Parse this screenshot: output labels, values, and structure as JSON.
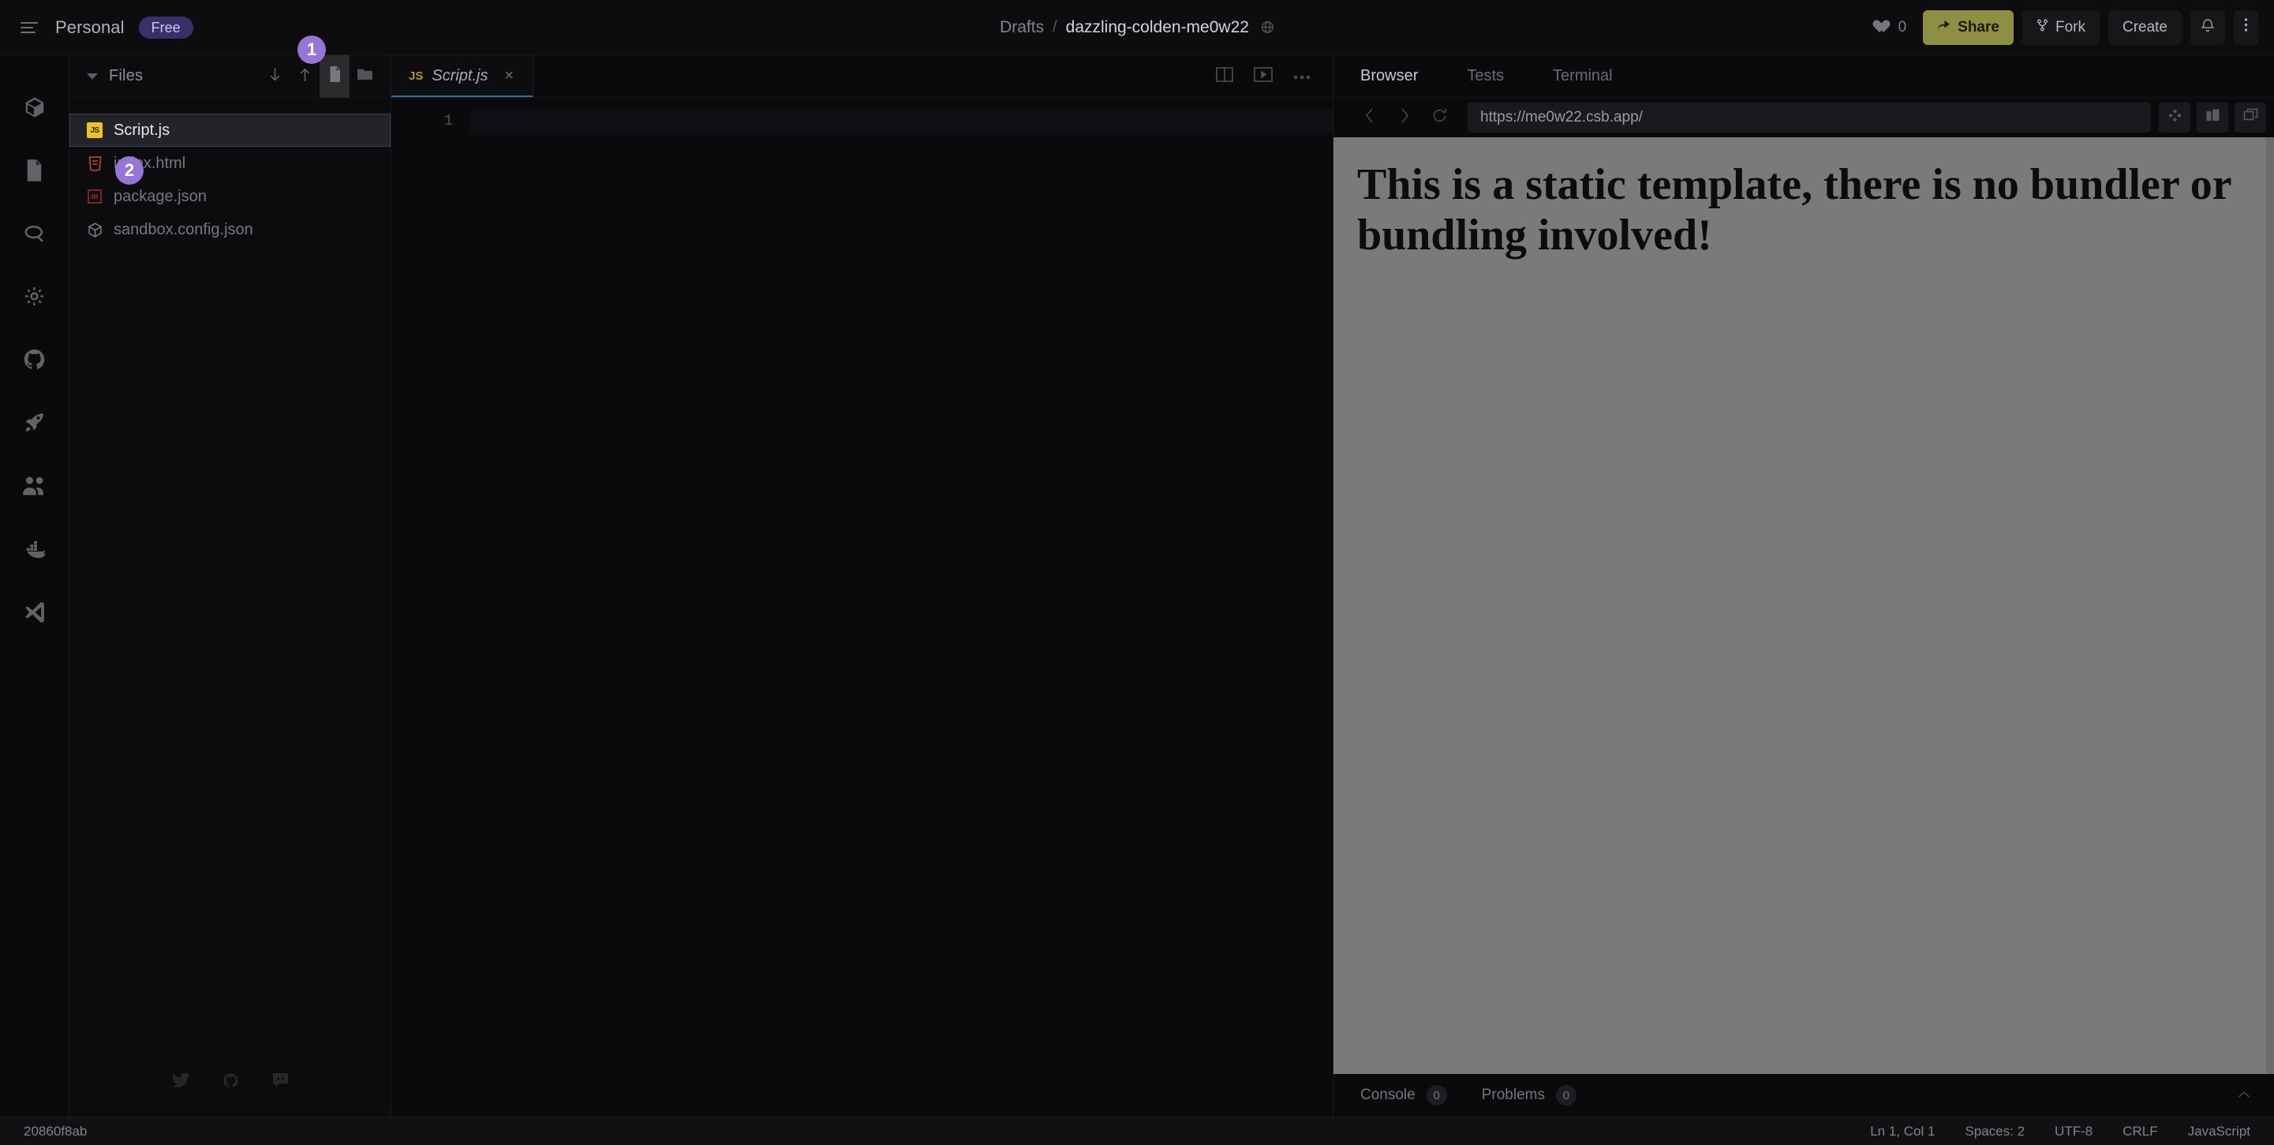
{
  "topbar": {
    "menu_icon": "hamburger-icon",
    "workspace": "Personal",
    "plan": "Free",
    "breadcrumb_root": "Drafts",
    "breadcrumb_sep": "/",
    "breadcrumb_current": "dazzling-colden-me0w22",
    "visibility_icon": "globe-icon",
    "like_count": "0",
    "share_label": "Share",
    "fork_label": "Fork",
    "create_label": "Create",
    "notifications_icon": "bell-icon",
    "more_icon": "more-vertical-icon",
    "share_bg": "#8d8f45",
    "plan_bg": "#3a2f6b"
  },
  "rail": {
    "items": [
      {
        "icon": "box-icon",
        "name": "sandbox-explorer"
      },
      {
        "icon": "file-icon",
        "name": "files"
      },
      {
        "icon": "search-icon",
        "name": "search"
      },
      {
        "icon": "gear-icon",
        "name": "settings"
      },
      {
        "icon": "github-icon",
        "name": "github"
      },
      {
        "icon": "rocket-icon",
        "name": "deploy"
      },
      {
        "icon": "people-icon",
        "name": "live-collaboration"
      },
      {
        "icon": "docker-icon",
        "name": "docker"
      },
      {
        "icon": "vscode-icon",
        "name": "open-in-vscode"
      }
    ]
  },
  "sidebar": {
    "title": "Files",
    "collapse_icon": "chevron-down-icon",
    "actions": [
      {
        "icon": "download-icon",
        "name": "download"
      },
      {
        "icon": "upload-icon",
        "name": "upload"
      },
      {
        "icon": "new-file-icon",
        "name": "new-file",
        "active": true
      },
      {
        "icon": "new-folder-icon",
        "name": "new-folder"
      }
    ],
    "files": [
      {
        "name": "Script.js",
        "icon": "js-icon",
        "selected": true
      },
      {
        "name": "index.html",
        "icon": "html-icon",
        "selected": false
      },
      {
        "name": "package.json",
        "icon": "npm-icon",
        "selected": false
      },
      {
        "name": "sandbox.config.json",
        "icon": "codesandbox-icon",
        "selected": false
      }
    ],
    "footer_icons": [
      "twitter-icon",
      "github-icon",
      "discord-icon"
    ]
  },
  "editor": {
    "tabs": [
      {
        "label": "Script.js",
        "badge": "JS",
        "close": "×",
        "active": true
      }
    ],
    "actions": [
      {
        "icon": "split-editor-icon",
        "name": "split-editor"
      },
      {
        "icon": "preview-icon",
        "name": "toggle-preview"
      },
      {
        "icon": "more-horizontal-icon",
        "name": "editor-options"
      }
    ],
    "line_numbers": [
      "1"
    ],
    "code_lines": [
      ""
    ]
  },
  "preview": {
    "tabs": [
      {
        "label": "Browser",
        "active": true
      },
      {
        "label": "Tests",
        "active": false
      },
      {
        "label": "Terminal",
        "active": false
      }
    ],
    "nav": {
      "back_icon": "chevron-left-icon",
      "forward_icon": "chevron-right-icon",
      "reload_icon": "reload-icon"
    },
    "url": "https://me0w22.csb.app/",
    "url_placeholder": "https://me0w22.csb.app/",
    "tools": [
      {
        "icon": "move-icon",
        "name": "pick-element"
      },
      {
        "icon": "responsive-icon",
        "name": "responsive-mode"
      },
      {
        "icon": "open-new-window-icon",
        "name": "open-in-new-window"
      }
    ],
    "page_heading": "This is a static template, there is no bundler or bundling involved!",
    "bottom_tabs": [
      {
        "label": "Console",
        "count": "0"
      },
      {
        "label": "Problems",
        "count": "0"
      }
    ],
    "expand_icon": "chevron-up-icon"
  },
  "statusbar": {
    "commit": "20860f8ab",
    "cursor": "Ln 1, Col 1",
    "indent": "Spaces: 2",
    "encoding": "UTF-8",
    "eol": "CRLF",
    "language": "JavaScript"
  },
  "annotations": [
    {
      "id": "1",
      "label": "1",
      "target": "new-file-button",
      "color": "#9575d6"
    },
    {
      "id": "2",
      "label": "2",
      "target": "file-row-script-js",
      "color": "#9575d6"
    }
  ]
}
